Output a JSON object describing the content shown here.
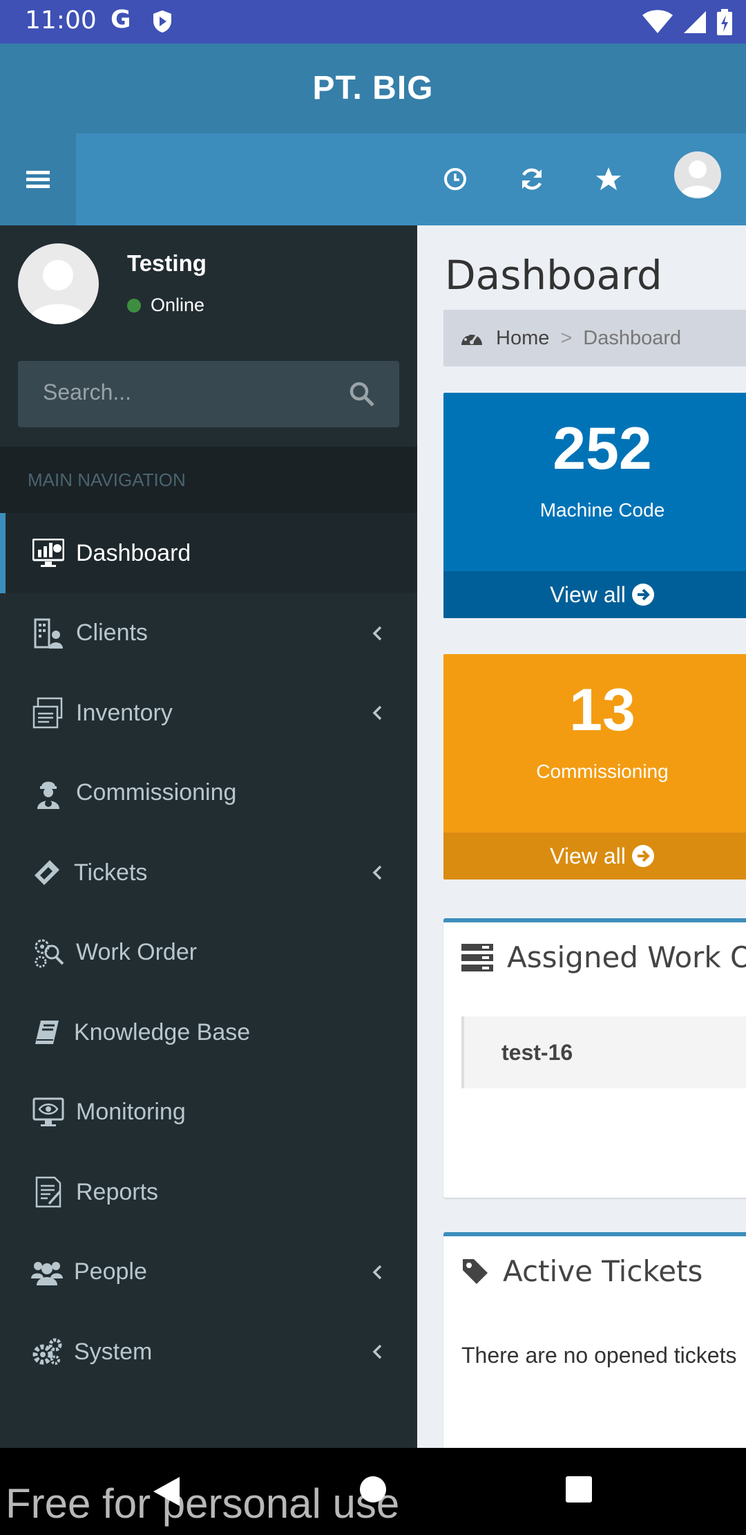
{
  "status_bar": {
    "time": "11:00",
    "g_label": "G"
  },
  "app": {
    "title": "PT. BIG"
  },
  "user": {
    "name": "Testing",
    "status": "Online"
  },
  "search": {
    "placeholder": "Search..."
  },
  "sidebar": {
    "header": "MAIN NAVIGATION",
    "items": [
      {
        "label": "Dashboard",
        "icon": "dashboard-icon",
        "active": true,
        "has_children": false
      },
      {
        "label": "Clients",
        "icon": "clients-icon",
        "active": false,
        "has_children": true
      },
      {
        "label": "Inventory",
        "icon": "inventory-icon",
        "active": false,
        "has_children": true
      },
      {
        "label": "Commissioning",
        "icon": "commissioning-icon",
        "active": false,
        "has_children": false
      },
      {
        "label": "Tickets",
        "icon": "ticket-icon",
        "active": false,
        "has_children": true
      },
      {
        "label": "Work Order",
        "icon": "work-order-icon",
        "active": false,
        "has_children": false
      },
      {
        "label": "Knowledge Base",
        "icon": "book-icon",
        "active": false,
        "has_children": false
      },
      {
        "label": "Monitoring",
        "icon": "monitor-icon",
        "active": false,
        "has_children": false
      },
      {
        "label": "Reports",
        "icon": "reports-icon",
        "active": false,
        "has_children": false
      },
      {
        "label": "People",
        "icon": "people-icon",
        "active": false,
        "has_children": true
      },
      {
        "label": "System",
        "icon": "gears-icon",
        "active": false,
        "has_children": true
      }
    ]
  },
  "main": {
    "page_title": "Dashboard",
    "breadcrumb": {
      "home": "Home",
      "separator": ">",
      "current": "Dashboard"
    },
    "stats": [
      {
        "value": "252",
        "label": "Machine Code",
        "link": "View all",
        "color": "#0073b7"
      },
      {
        "value": "13",
        "label": "Commissioning",
        "link": "View all",
        "color": "#f39c12"
      }
    ],
    "work_orders": {
      "title": "Assigned Work Orders",
      "items": [
        "test-16"
      ]
    },
    "tickets": {
      "title": "Active Tickets",
      "empty_text": "There are no opened tickets"
    }
  },
  "colors": {
    "primary": "#3c8dbc",
    "sidebar": "#222d32",
    "status_bar": "#3f51b5"
  },
  "watermark": "Free for personal use"
}
